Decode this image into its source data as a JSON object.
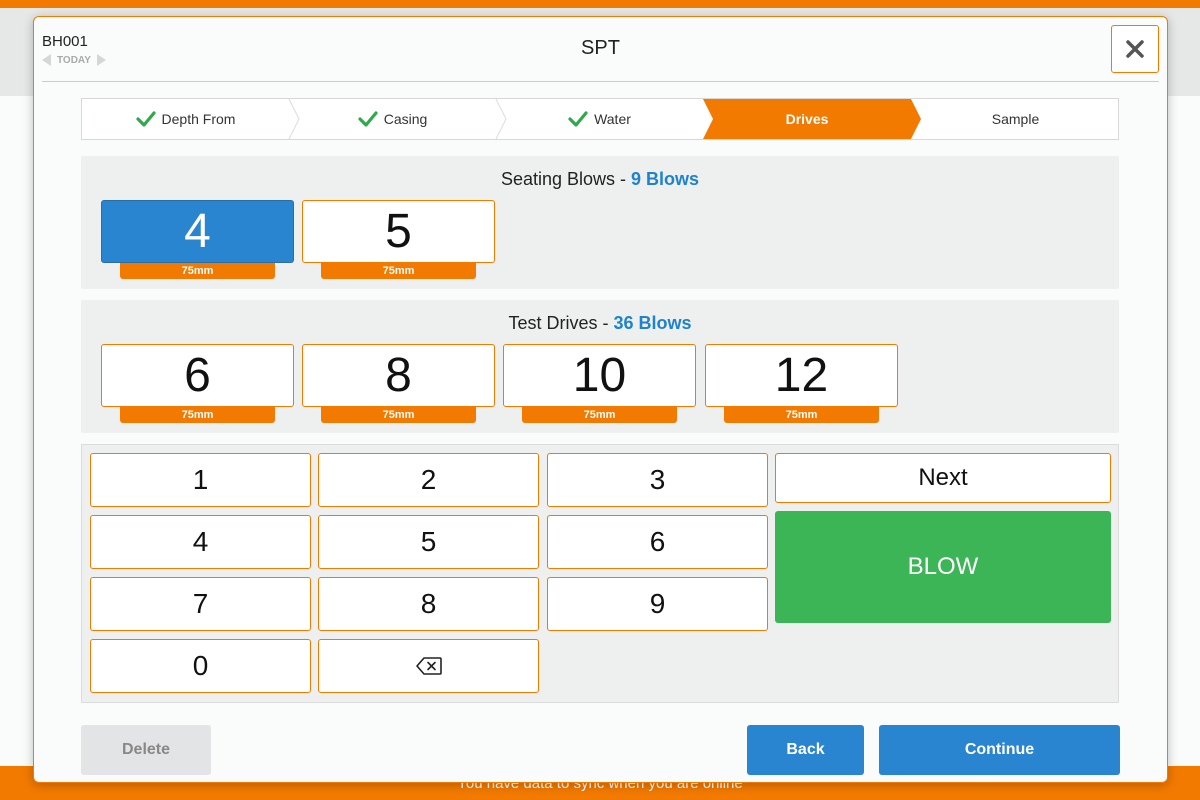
{
  "background": {
    "footer_text": "You have data to sync when you are online"
  },
  "modal": {
    "hole_id": "BH001",
    "date_label": "TODAY",
    "title": "SPT",
    "close_icon": "close-icon"
  },
  "steps": [
    {
      "label": "Depth From",
      "state": "done"
    },
    {
      "label": "Casing",
      "state": "done"
    },
    {
      "label": "Water",
      "state": "done"
    },
    {
      "label": "Drives",
      "state": "active"
    },
    {
      "label": "Sample",
      "state": "pending"
    }
  ],
  "seating": {
    "title": "Seating Blows",
    "separator": " - ",
    "count": "9 Blows",
    "drives": [
      {
        "value": "4",
        "length": "75mm",
        "selected": true
      },
      {
        "value": "5",
        "length": "75mm",
        "selected": false
      }
    ]
  },
  "test": {
    "title": "Test Drives",
    "separator": " - ",
    "count": "36 Blows",
    "drives": [
      {
        "value": "6",
        "length": "75mm"
      },
      {
        "value": "8",
        "length": "75mm"
      },
      {
        "value": "10",
        "length": "75mm"
      },
      {
        "value": "12",
        "length": "75mm"
      }
    ]
  },
  "keypad": {
    "keys": [
      "1",
      "2",
      "3",
      "4",
      "5",
      "6",
      "7",
      "8",
      "9",
      "0"
    ],
    "backspace_icon": "backspace-icon",
    "next_label": "Next",
    "blow_label": "BLOW"
  },
  "buttons": {
    "delete": "Delete",
    "back": "Back",
    "continue": "Continue"
  },
  "colors": {
    "accent": "#f27a00",
    "primary": "#2a85d0",
    "success": "#3bb556",
    "check": "#2eaa4a",
    "count_text": "#1e82cf"
  }
}
